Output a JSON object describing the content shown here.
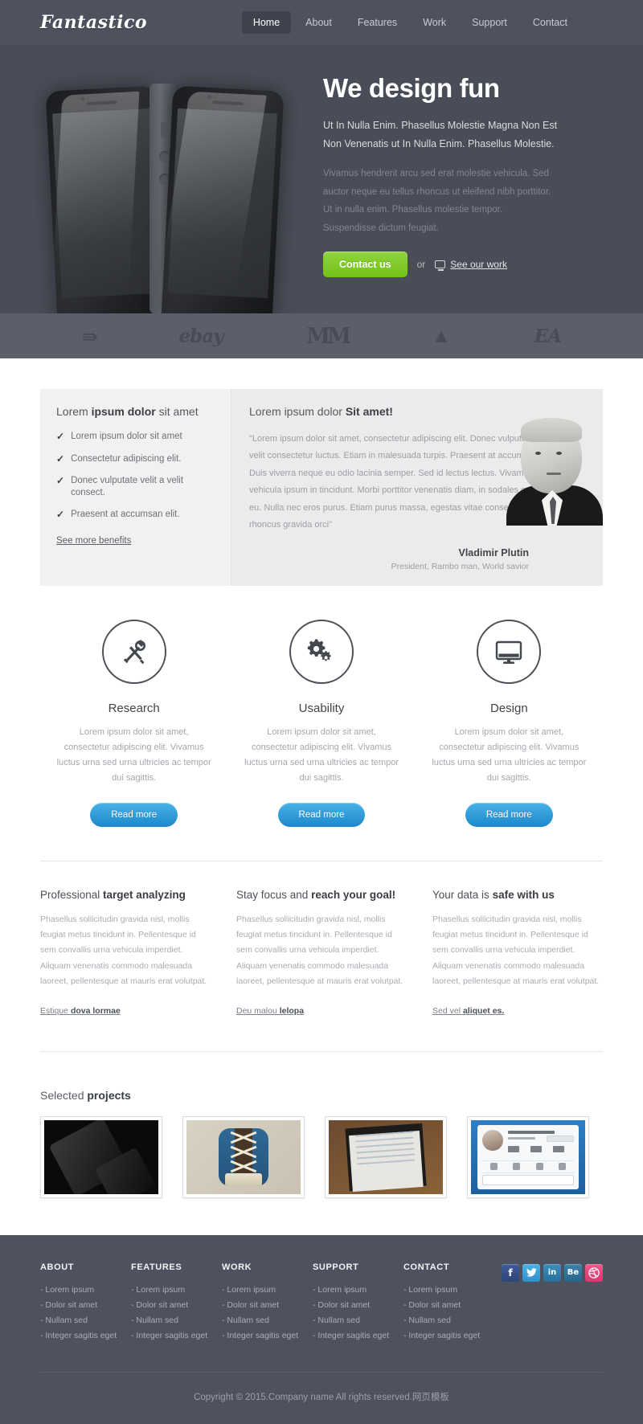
{
  "header": {
    "logo": "Fantastico",
    "nav": [
      {
        "label": "Home",
        "active": true
      },
      {
        "label": "About",
        "active": false
      },
      {
        "label": "Features",
        "active": false
      },
      {
        "label": "Work",
        "active": false
      },
      {
        "label": "Support",
        "active": false
      },
      {
        "label": "Contact",
        "active": false
      }
    ]
  },
  "hero": {
    "title": "We design fun",
    "subtitle": "Ut In Nulla Enim. Phasellus Molestie Magna Non Est Non Venenatis ut In Nulla Enim. Phasellus Molestie.",
    "body": "Vivamus hendrerit arcu sed erat molestie vehicula. Sed auctor neque eu tellus rhoncus ut eleifend nibh porttitor. Ut in nulla enim. Phasellus molestie tempor. Suspendisse dictum feugiat.",
    "cta_primary": "Contact us",
    "or": "or",
    "cta_secondary": "See our work"
  },
  "clients": [
    {
      "name": "arrow-logo",
      "glyph": "⇛"
    },
    {
      "name": "ebay-logo",
      "glyph": "ebay"
    },
    {
      "name": "mcdonalds-logo",
      "glyph": "MM"
    },
    {
      "name": "adidas-logo",
      "glyph": "▲"
    },
    {
      "name": "ea-logo",
      "glyph": "EA"
    }
  ],
  "benefits": {
    "title_pre": "Lorem ",
    "title_bold": "ipsum dolor",
    "title_post": " sit amet",
    "items": [
      "Lorem ipsum dolor sit amet",
      "Consectetur adipiscing elit.",
      "Donec vulputate velit a velit consect.",
      "Praesent at accumsan elit."
    ],
    "link": "See more benefits"
  },
  "testimonial": {
    "title_pre": "Lorem ipsum dolor ",
    "title_bold": "Sit amet!",
    "quote": "\"Lorem ipsum dolor sit amet, consectetur adipiscing elit. Donec vulputate velit a velit consectetur luctus. Etiam in malesuada turpis. Praesent at accumsan elit. Duis viverra neque eu odio lacinia semper. Sed id lectus lectus. Vivamus hendrerit vehicula ipsum in tincidunt. Morbi porttitor venenatis diam, in sodales odio sagittis eu. Nulla nec eros purus. Etiam purus massa, egestas vitae consequat non, rhoncus gravida orci\"",
    "author": "Vladimir Plutin",
    "role": "President, Rambo man, World savior"
  },
  "features": [
    {
      "icon": "tools-icon",
      "title": "Research",
      "text": "Lorem ipsum dolor sit amet, consectetur adipiscing elit. Vivamus luctus urna sed urna ultricies ac tempor dui sagittis.",
      "button": "Read more"
    },
    {
      "icon": "gears-icon",
      "title": "Usability",
      "text": "Lorem ipsum dolor sit amet, consectetur adipiscing elit. Vivamus luctus urna sed urna ultricies ac tempor dui sagittis.",
      "button": "Read more"
    },
    {
      "icon": "monitor-icon",
      "title": "Design",
      "text": "Lorem ipsum dolor sit amet, consectetur adipiscing elit. Vivamus luctus urna sed urna ultricies ac tempor dui sagittis.",
      "button": "Read more"
    }
  ],
  "textcols": [
    {
      "head_pre": "Professional ",
      "head_bold": "target analyzing",
      "body": "Phasellus sollicitudin gravida nisl, mollis feugiat metus tincidunt in. Pellentesque id sem convallis urna vehicula imperdiet. Aliquam venenatis commodo malesuada laoreet, pellentesque at mauris erat volutpat.",
      "link_pre": "Estique ",
      "link_bold": "dova lormae"
    },
    {
      "head_pre": "Stay focus and ",
      "head_bold": "reach your goal!",
      "body": "Phasellus sollicitudin gravida nisl, mollis feugiat metus tincidunt in. Pellentesque id sem convallis urna vehicula imperdiet. Aliquam venenatis commodo malesuada laoreet, pellentesque at mauris erat volutpat.",
      "link_pre": "Deu malou ",
      "link_bold": "lelopa"
    },
    {
      "head_pre": "Your data is ",
      "head_bold": "safe with us",
      "body": "Phasellus sollicitudin gravida nisl, mollis feugiat metus tincidunt in. Pellentesque id sem convallis urna vehicula imperdiet. Aliquam venenatis commodo malesuada laoreet, pellentesque at mauris erat volutpat.",
      "link_pre": "Sed vel ",
      "link_bold": "aliquet es."
    }
  ],
  "projects": {
    "title_pre": "Selected ",
    "title_bold": "projects",
    "items": [
      {
        "name": "project-thumb-phones"
      },
      {
        "name": "project-thumb-shoelace-app"
      },
      {
        "name": "project-thumb-wireframe"
      },
      {
        "name": "project-thumb-profile-ui"
      }
    ]
  },
  "footer": {
    "columns": [
      {
        "heading": "ABOUT",
        "links": [
          "- Lorem ipsum",
          "- Dolor sit amet",
          "- Nullam sed",
          "- Integer sagitis eget"
        ]
      },
      {
        "heading": "FEATURES",
        "links": [
          "- Lorem ipsum",
          "- Dolor sit amet",
          "- Nullam sed",
          "- Integer sagitis eget"
        ]
      },
      {
        "heading": "WORK",
        "links": [
          "- Lorem ipsum",
          "- Dolor sit amet",
          "- Nullam sed",
          "- Integer sagitis eget"
        ]
      },
      {
        "heading": "SUPPORT",
        "links": [
          "- Lorem ipsum",
          "- Dolor sit amet",
          "- Nullam sed",
          "- Integer sagitis eget"
        ]
      },
      {
        "heading": "CONTACT",
        "links": [
          "- Lorem ipsum",
          "- Dolor sit amet",
          "- Nullam sed",
          "- Integer sagitis eget"
        ]
      }
    ],
    "social": [
      {
        "name": "facebook-icon",
        "glyph": "f"
      },
      {
        "name": "twitter-icon",
        "glyph": "ᵗ"
      },
      {
        "name": "linkedin-icon",
        "glyph": "in"
      },
      {
        "name": "behance-icon",
        "glyph": "Be"
      },
      {
        "name": "dribbble-icon",
        "glyph": "◎"
      }
    ],
    "copyright": "Copyright © 2015.Company name All rights reserved.网页模板"
  },
  "colors": {
    "header_bg": "#4e525e",
    "hero_bg": "#494d57",
    "clients_bg": "#5b5f6b",
    "accent_green": "#7ec92a",
    "accent_blue": "#1c87cb",
    "footer_bg": "#4e525e"
  }
}
